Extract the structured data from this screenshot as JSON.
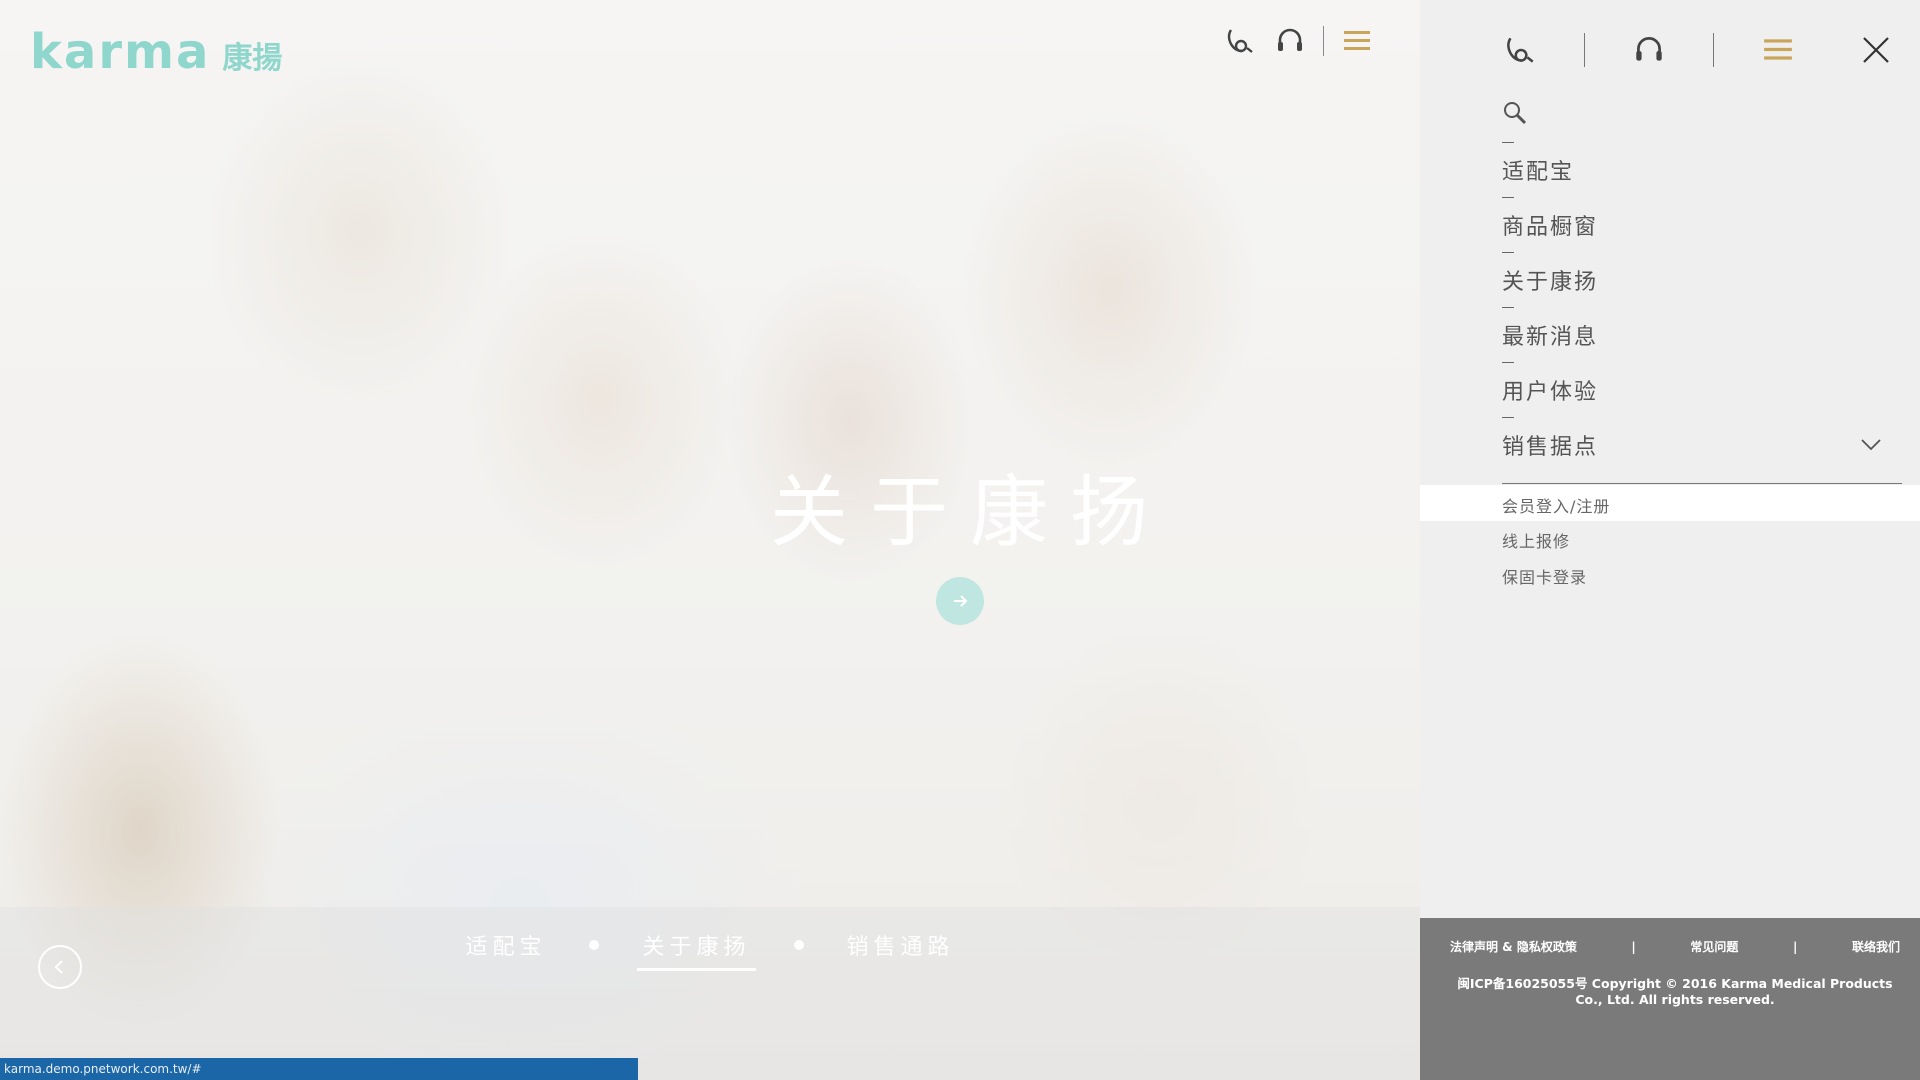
{
  "logo": {
    "brand_en": "karma",
    "brand_zh": "康揚"
  },
  "icons": {
    "wrench": "wrench-icon",
    "headset": "headset-icon",
    "menu": "menu-icon",
    "close": "close-icon",
    "search": "search-icon",
    "chevron": "chevron-down-icon",
    "prev": "chevron-left-icon",
    "next": "arrow-right-icon"
  },
  "colors": {
    "brand_teal": "#8fd6cc",
    "menu_gold": "#c9a55a",
    "footer_bg": "#7a7a7a",
    "status_blue": "#1b66a6"
  },
  "hero": {
    "title": "关于康扬",
    "tabs": [
      {
        "label": "适配宝",
        "active": false
      },
      {
        "label": "关于康扬",
        "active": true
      },
      {
        "label": "销售通路",
        "active": false
      }
    ]
  },
  "panel": {
    "menu": [
      {
        "label": "适配宝"
      },
      {
        "label": "商品橱窗"
      },
      {
        "label": "关于康扬"
      },
      {
        "label": "最新消息"
      },
      {
        "label": "用户体验"
      },
      {
        "label": "销售据点"
      }
    ],
    "sub_links": [
      {
        "label": "会员登入/注册"
      },
      {
        "label": "线上报修"
      },
      {
        "label": "保固卡登录"
      }
    ],
    "footer": {
      "links": [
        "法律声明 & 隐私权政策",
        "常见问题",
        "联络我们"
      ],
      "copyright": "闽ICP备16025055号 Copyright © 2016 Karma Medical Products Co., Ltd. All rights reserved."
    }
  },
  "status_bar": {
    "url": "karma.demo.pnetwork.com.tw/#"
  }
}
